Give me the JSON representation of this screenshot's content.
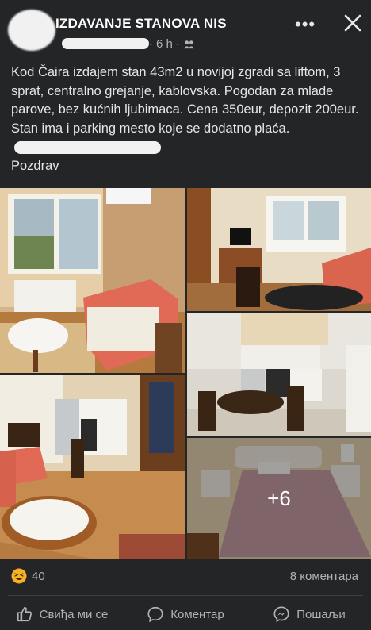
{
  "header": {
    "group_name": "IZDAVANJE STANOVA NIS",
    "time": "6 h",
    "privacy_icon": "group-privacy-icon",
    "more_icon": "more-dots-icon",
    "close_icon": "close-icon"
  },
  "post": {
    "text": "Kod Čaira izdajem stan 43m2 u novijoj zgradi sa liftom, 3 sprat, centralno grejanje, kablovska. Pogodan za mlade parove, bez kućnih ljubimaca. Cena 350eur, depozit 200eur. Stan ima i parking mesto koje se dodatno plaća.",
    "signoff": "Pozdrav"
  },
  "photos": {
    "more_count": "+6"
  },
  "stats": {
    "reaction_count": "40",
    "comments": "8 коментара"
  },
  "actions": {
    "like": "Свиђа ми се",
    "comment": "Коментар",
    "share": "Пошаљи"
  },
  "colors": {
    "background": "#242526",
    "text": "#e4e6eb",
    "secondary": "#b0b3b8",
    "reaction": "#f7b125"
  }
}
